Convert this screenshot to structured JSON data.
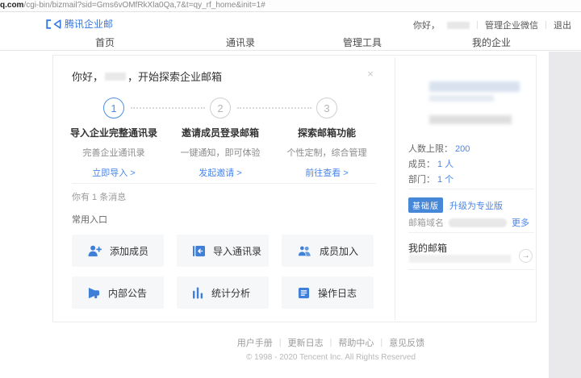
{
  "browser": {
    "url_host": "q.com",
    "url_path": "/cgi-bin/bizmail?sid=Gms6vOMfRkXla0Qa,7&t=qy_rf_home&init=1#"
  },
  "header": {
    "logo_text": "腾讯企业邮",
    "greeting_prefix": "你好，",
    "manage_link": "管理企业微信",
    "logout_link": "退出"
  },
  "nav": {
    "tabs": [
      {
        "label": "首页"
      },
      {
        "label": "通讯录"
      },
      {
        "label": "管理工具"
      },
      {
        "label": "我的企业"
      }
    ]
  },
  "onboarding": {
    "greeting_prefix": "你好，",
    "greeting_suffix": "，开始探索企业邮箱",
    "close_glyph": "×",
    "steps": [
      {
        "num": "1",
        "title": "导入企业完整通讯录",
        "desc": "完善企业通讯录",
        "link": "立即导入 >"
      },
      {
        "num": "2",
        "title": "邀请成员登录邮箱",
        "desc": "一键通知，即可体验",
        "link": "发起邀请 >"
      },
      {
        "num": "3",
        "title": "探索邮箱功能",
        "desc": "个性定制，综合管理",
        "link": "前往查看 >"
      }
    ],
    "message_line": "你有 1 条消息"
  },
  "quick_entry": {
    "title": "常用入口",
    "items": [
      {
        "label": "添加成员",
        "icon": "add-member-icon"
      },
      {
        "label": "导入通讯录",
        "icon": "import-contacts-icon"
      },
      {
        "label": "成员加入",
        "icon": "member-join-icon"
      },
      {
        "label": "内部公告",
        "icon": "announcement-icon"
      },
      {
        "label": "统计分析",
        "icon": "statistics-icon"
      },
      {
        "label": "操作日志",
        "icon": "operation-log-icon"
      }
    ]
  },
  "sidebar": {
    "stats": [
      {
        "label": "人数上限：",
        "value": "200"
      },
      {
        "label": "成员：",
        "value": "1 人"
      },
      {
        "label": "部门：",
        "value": "1 个"
      }
    ],
    "plan_badge": "基础版",
    "upgrade_link": "升级为专业版",
    "domain_label": "邮箱域名",
    "more_link": "更多",
    "mailbox_title": "我的邮箱",
    "arrow_glyph": "→"
  },
  "footer": {
    "links": [
      {
        "label": "用户手册"
      },
      {
        "label": "更新日志"
      },
      {
        "label": "帮助中心"
      },
      {
        "label": "意见反馈"
      }
    ],
    "copyright": "© 1998 - 2020 Tencent Inc. All Rights Reserved"
  },
  "colors": {
    "accent": "#3577e0",
    "link": "#4a86e8",
    "badge": "#4687d8",
    "icon_blue": "#3f7fd8",
    "step_active": "#4a90e2"
  }
}
